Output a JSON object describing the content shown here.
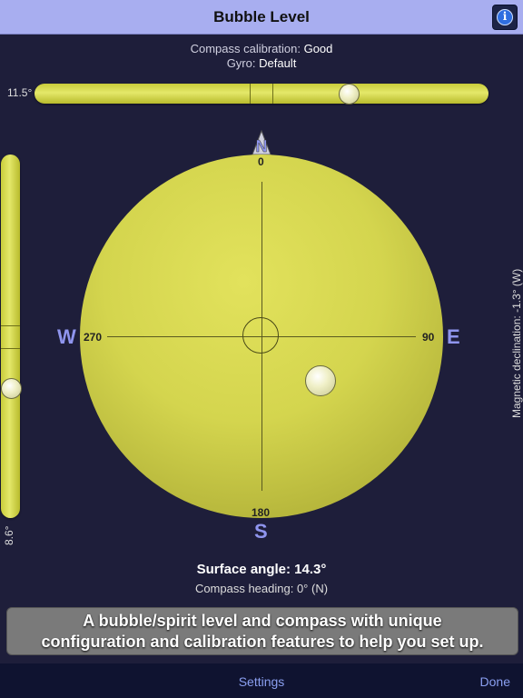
{
  "header": {
    "title": "Bubble Level",
    "info_icon": "info-icon"
  },
  "calibration": {
    "compass_label": "Compass calibration:",
    "compass_value": "Good",
    "gyro_label": "Gyro:",
    "gyro_value": "Default"
  },
  "horizontal_level": {
    "angle_label": "11.5°",
    "bubble_fraction": 0.7
  },
  "vertical_level": {
    "angle_label": "8.6°",
    "bubble_fraction": 0.65
  },
  "compass": {
    "north": "N",
    "south": "S",
    "east": "E",
    "west": "W",
    "deg_0": "0",
    "deg_90": "90",
    "deg_180": "180",
    "deg_270": "270",
    "colors": {
      "dial": "#d4d54e",
      "cardinal": "#8f95ee"
    }
  },
  "declination_label": "Magnetic declination: -1.3° (W)",
  "readings": {
    "surface_angle": "Surface angle: 14.3°",
    "compass_heading": "Compass heading: 0° (N)"
  },
  "banner": {
    "line1": "A bubble/spirit level and compass with unique",
    "line2": "configuration and calibration features to help you set up."
  },
  "toolbar": {
    "settings_label": "Settings",
    "done_label": "Done"
  }
}
